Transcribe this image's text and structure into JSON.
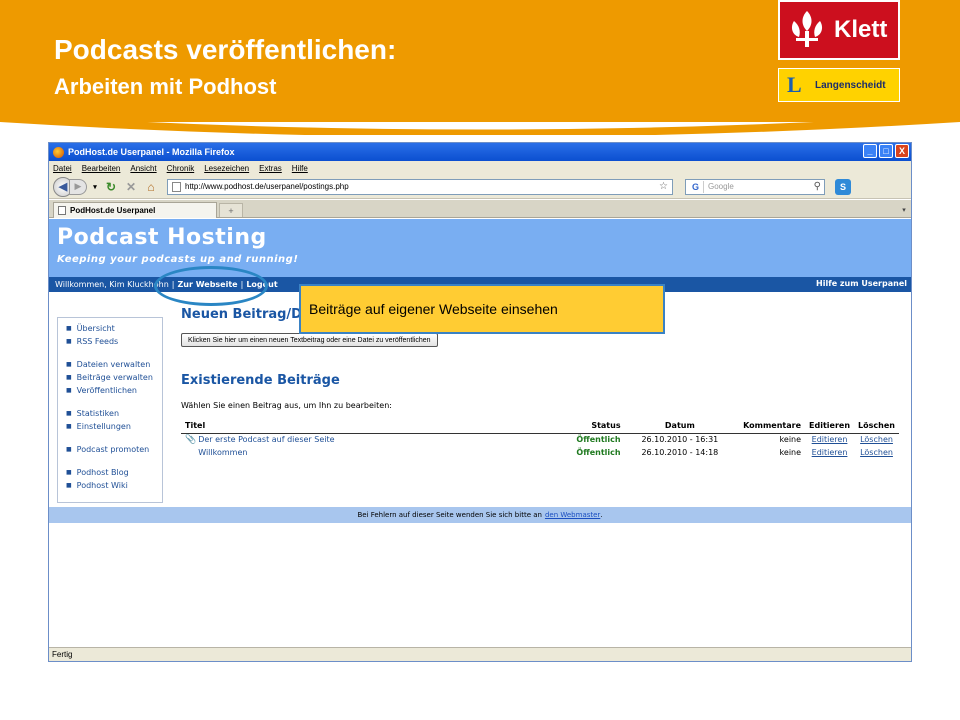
{
  "slide": {
    "title": "Podcasts veröffentlichen:",
    "subtitle": "Arbeiten mit Podhost",
    "logos": {
      "klett": "Klett",
      "langenscheidt_mark": "L",
      "langenscheidt": "Langenscheidt"
    },
    "colors": {
      "banner": "#ee9a00",
      "klett_red": "#cc0f1e",
      "langenscheidt_yellow": "#ffd200",
      "callout": "#ffcc33",
      "highlight": "#2a86c4"
    }
  },
  "browser": {
    "window_title": "PodHost.de Userpanel - Mozilla Firefox",
    "window_buttons": [
      "_",
      "□",
      "X"
    ],
    "menu": [
      "Datei",
      "Bearbeiten",
      "Ansicht",
      "Chronik",
      "Lesezeichen",
      "Extras",
      "Hilfe"
    ],
    "url": "http://www.podhost.de/userpanel/postings.php",
    "search_placeholder": "Google",
    "search_engine_icon": "G",
    "tab_title": "PodHost.de Userpanel",
    "new_tab_symbol": "+",
    "status": "Fertig",
    "icons": {
      "back": "back-arrow-icon",
      "forward": "forward-arrow-icon",
      "reload": "reload-icon",
      "stop": "stop-icon",
      "home": "home-icon"
    }
  },
  "site": {
    "title": "Podcast Hosting",
    "slogan": "Keeping your podcasts up and running!",
    "welcome": "Willkommen, Kim Kluckhohn",
    "nav_separator": "|",
    "nav_links": [
      "Zur Webseite",
      "Logout"
    ],
    "help_link": "Hilfe zum Userpanel",
    "sidebar_groups": [
      [
        "Übersicht",
        "RSS Feeds"
      ],
      [
        "Dateien verwalten",
        "Beiträge verwalten",
        "Veröffentlichen"
      ],
      [
        "Statistiken",
        "Einstellungen"
      ],
      [
        "Podcast promoten"
      ],
      [
        "Podhost Blog",
        "Podhost Wiki"
      ]
    ],
    "new_post_heading": "Neuen Beitrag/Datei",
    "new_post_button": "Klicken Sie hier um einen neuen Textbeitrag oder eine Datei zu veröffentlichen",
    "existing_heading": "Existierende Beiträge",
    "instruction": "Wählen Sie einen Beitrag aus, um Ihn zu bearbeiten:",
    "table": {
      "headers": [
        "Titel",
        "Status",
        "Datum",
        "Kommentare",
        "Editieren",
        "Löschen"
      ],
      "rows": [
        {
          "title": "Der erste Podcast auf dieser Seite",
          "attachment": true,
          "status": "Öffentlich",
          "date": "26.10.2010 - 16:31",
          "comments": "keine",
          "edit": "Editieren",
          "delete": "Löschen"
        },
        {
          "title": "Willkommen",
          "attachment": false,
          "status": "Öffentlich",
          "date": "26.10.2010 - 14:18",
          "comments": "keine",
          "edit": "Editieren",
          "delete": "Löschen"
        }
      ]
    },
    "footer_text": "Bei Fehlern auf dieser Seite wenden Sie sich bitte an",
    "footer_link": "den Webmaster",
    "footer_end": "."
  },
  "callout": {
    "text": "Beiträge auf eigener Webseite einsehen"
  }
}
